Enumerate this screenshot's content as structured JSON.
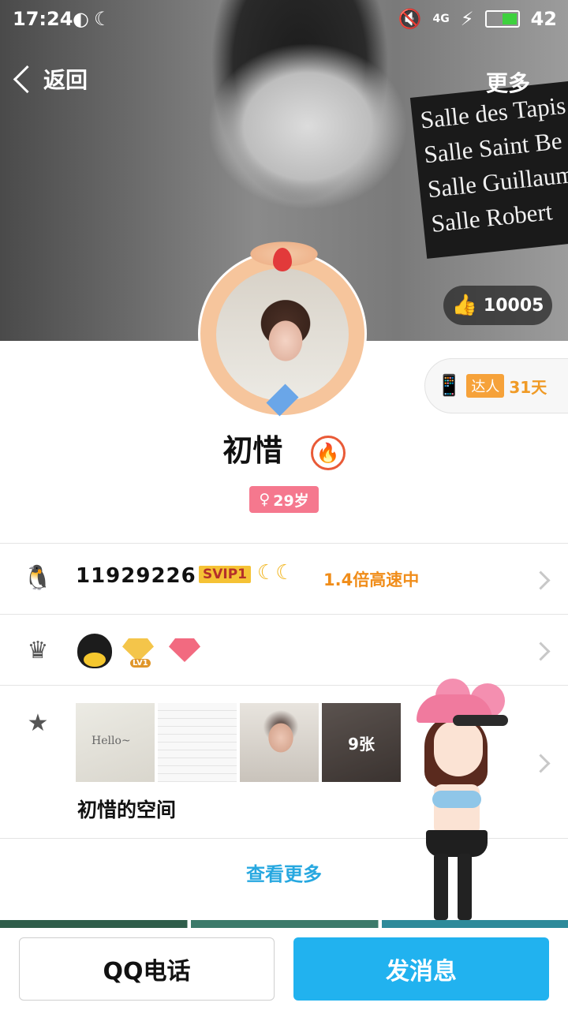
{
  "status_bar": {
    "time": "17:24",
    "network": "4G",
    "battery": "42"
  },
  "header": {
    "back_label": "返回",
    "more_label": "更多"
  },
  "cover": {
    "sign_lines": [
      "Salle des Tapis",
      "Salle Saint Be",
      "Salle Guillaum",
      "Salle Robert"
    ]
  },
  "likes": {
    "count": "10005"
  },
  "daren": {
    "tag": "达人",
    "days": "31天"
  },
  "profile": {
    "name": "初惜",
    "age": "29岁"
  },
  "account_row": {
    "qq_number": "11929226",
    "svip_label": "SVIP1",
    "moons": "☾☾",
    "speed_text": "1.4倍高速中"
  },
  "badges_row": {
    "lv_label": "LV1"
  },
  "qzone_row": {
    "photo_hello": "Hello~",
    "photo_count": "9张",
    "title": "初惜的空间"
  },
  "view_more": "查看更多",
  "bottom": {
    "call_label": "QQ电话",
    "message_label": "发消息"
  },
  "colors": {
    "accent": "#21b2ef",
    "link": "#27a8e0",
    "age_badge": "#f5788e",
    "daren": "#f09a25"
  }
}
